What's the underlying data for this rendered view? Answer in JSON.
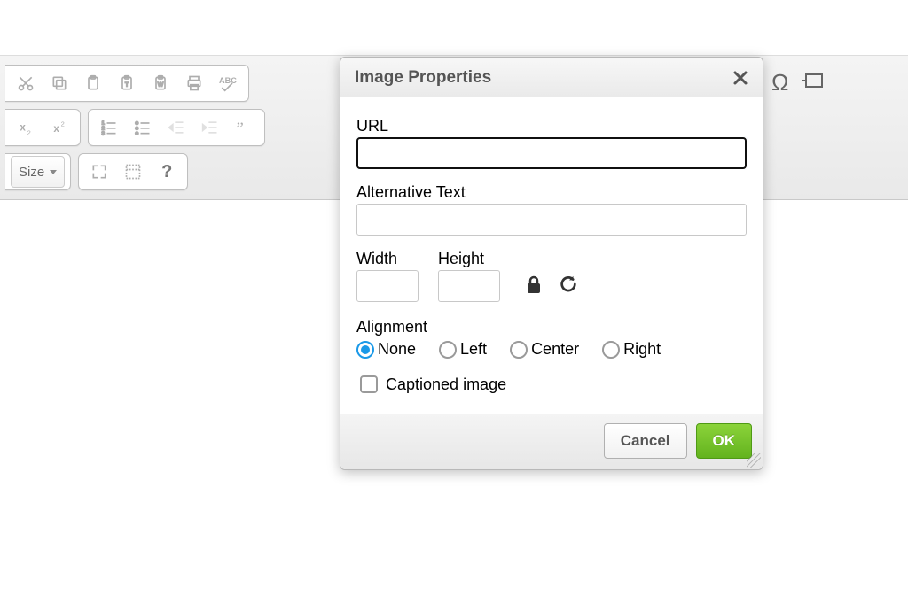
{
  "toolbar": {
    "size_button": "Size",
    "question": "?"
  },
  "dialog": {
    "title": "Image Properties",
    "url_label": "URL",
    "url_value": "",
    "alt_label": "Alternative Text",
    "alt_value": "",
    "width_label": "Width",
    "width_value": "",
    "height_label": "Height",
    "height_value": "",
    "alignment_label": "Alignment",
    "alignment_options": {
      "none": "None",
      "left": "Left",
      "center": "Center",
      "right": "Right"
    },
    "alignment_selected": "none",
    "captioned_label": "Captioned image",
    "captioned_checked": false,
    "cancel_label": "Cancel",
    "ok_label": "OK"
  }
}
